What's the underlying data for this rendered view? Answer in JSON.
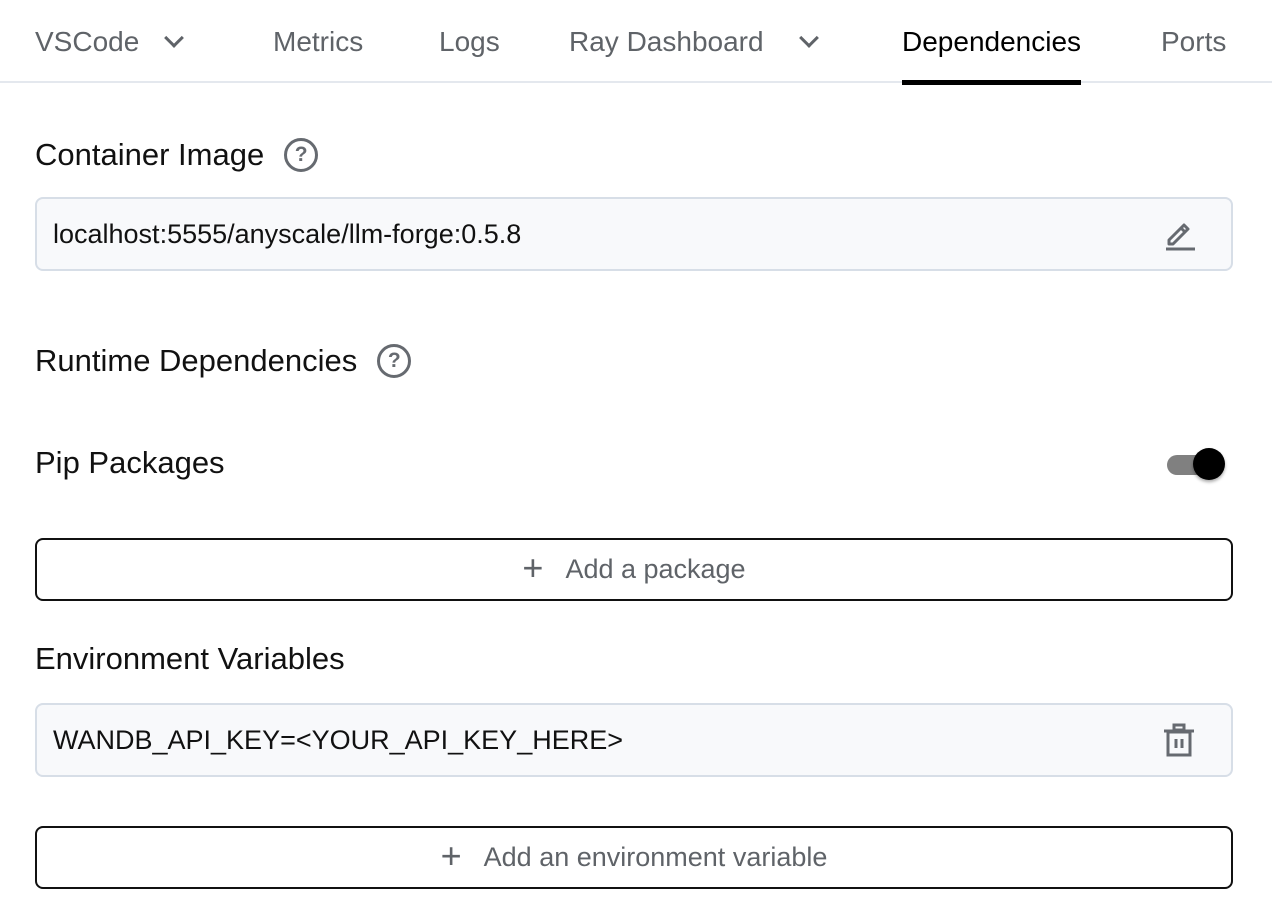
{
  "tabs": [
    {
      "label": "VSCode",
      "has_dropdown": true,
      "active": false
    },
    {
      "label": "Metrics",
      "has_dropdown": false,
      "active": false
    },
    {
      "label": "Logs",
      "has_dropdown": false,
      "active": false
    },
    {
      "label": "Ray Dashboard",
      "has_dropdown": true,
      "active": false
    },
    {
      "label": "Dependencies",
      "has_dropdown": false,
      "active": true
    },
    {
      "label": "Ports",
      "has_dropdown": false,
      "active": false
    }
  ],
  "container_image": {
    "title": "Container Image",
    "help_icon": "question-circle-icon",
    "value": "localhost:5555/anyscale/llm-forge:0.5.8",
    "action_icon": "pencil-edit-icon"
  },
  "runtime_dependencies": {
    "title": "Runtime Dependencies",
    "help_icon": "question-circle-icon"
  },
  "pip_packages": {
    "title": "Pip Packages",
    "toggle_on": true,
    "add_label": "Add a package",
    "add_icon": "plus-icon"
  },
  "environment_variables": {
    "title": "Environment Variables",
    "items": [
      {
        "value": "WANDB_API_KEY=<YOUR_API_KEY_HERE>",
        "action_icon": "trash-icon"
      }
    ],
    "add_label": "Add an environment variable",
    "add_icon": "plus-icon"
  },
  "colors": {
    "active_tab": "#000000",
    "inactive_tab": "#5f6368",
    "field_bg": "#f8f9fb",
    "field_border": "#d7dee7",
    "toggle_thumb": "#000000",
    "toggle_track": "#808080"
  }
}
